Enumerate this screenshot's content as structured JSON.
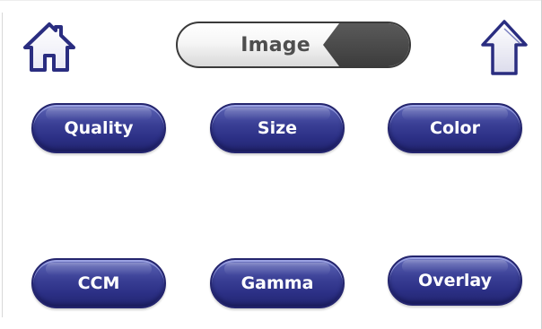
{
  "header": {
    "title": "Image",
    "home_icon": "home-icon",
    "up_icon": "arrow-up-icon",
    "back_icon": "back-tab-icon"
  },
  "buttons": [
    {
      "label": "Quality"
    },
    {
      "label": "Size"
    },
    {
      "label": "Color"
    },
    {
      "label": "CCM"
    },
    {
      "label": "Gamma"
    },
    {
      "label": "Overlay"
    }
  ],
  "colors": {
    "button_fill": "#2c3086",
    "button_border": "#24256e",
    "icon_stroke": "#2a2d80",
    "title_text": "#4e4e4e",
    "back_tab": "#4a4a4a"
  }
}
